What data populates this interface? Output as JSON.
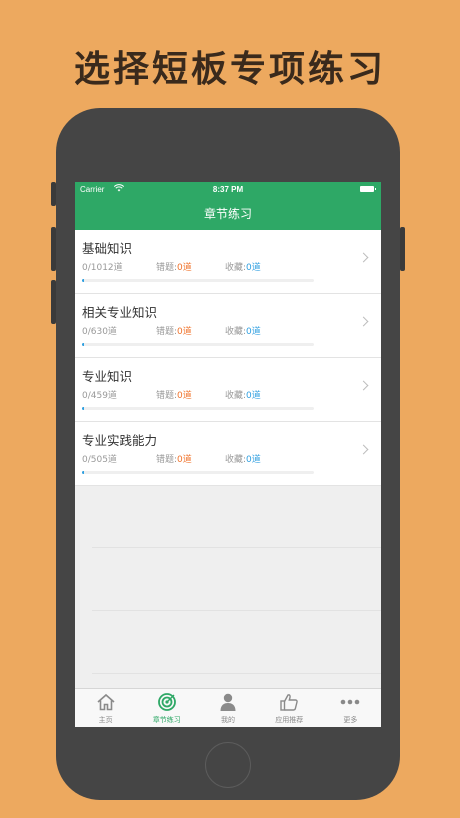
{
  "headline": "选择短板专项练习",
  "status_bar": {
    "carrier": "Carrier",
    "time": "8:37 PM"
  },
  "nav": {
    "title": "章节练习"
  },
  "chapters": [
    {
      "title": "基础知识",
      "progress": "0/1012道",
      "wrong_label": "错题:",
      "wrong_value": "0道",
      "fav_label": "收藏:",
      "fav_value": "0道"
    },
    {
      "title": "相关专业知识",
      "progress": "0/630道",
      "wrong_label": "错题:",
      "wrong_value": "0道",
      "fav_label": "收藏:",
      "fav_value": "0道"
    },
    {
      "title": "专业知识",
      "progress": "0/459道",
      "wrong_label": "错题:",
      "wrong_value": "0道",
      "fav_label": "收藏:",
      "fav_value": "0道"
    },
    {
      "title": "专业实践能力",
      "progress": "0/505道",
      "wrong_label": "错题:",
      "wrong_value": "0道",
      "fav_label": "收藏:",
      "fav_value": "0道"
    }
  ],
  "tabs": [
    {
      "label": "主页",
      "icon": "home-icon"
    },
    {
      "label": "章节练习",
      "icon": "target-icon",
      "active": true
    },
    {
      "label": "我的",
      "icon": "user-icon"
    },
    {
      "label": "应用推荐",
      "icon": "thumbs-up-icon"
    },
    {
      "label": "更多",
      "icon": "more-dots-icon"
    }
  ],
  "colors": {
    "background": "#EDA95F",
    "accent": "#2EA866",
    "wrong": "#F0722A",
    "favorite": "#2F9FE0"
  }
}
